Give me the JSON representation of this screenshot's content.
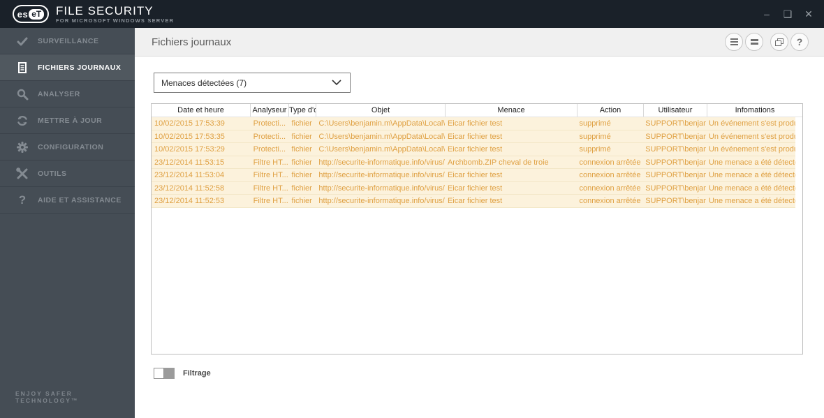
{
  "brand": {
    "logo_left": "es",
    "logo_right": "eT",
    "product": "FILE SECURITY",
    "subtitle": "FOR MICROSOFT WINDOWS SERVER"
  },
  "window_controls": {
    "minimize_glyph": "–",
    "maximize_glyph": "❑",
    "close_glyph": "✕"
  },
  "sidebar": {
    "items": [
      {
        "label": "SURVEILLANCE",
        "icon": "check-icon",
        "active": false
      },
      {
        "label": "FICHIERS JOURNAUX",
        "icon": "log-file-icon",
        "active": true
      },
      {
        "label": "ANALYSER",
        "icon": "search-icon",
        "active": false
      },
      {
        "label": "METTRE À JOUR",
        "icon": "update-arrows-icon",
        "active": false
      },
      {
        "label": "CONFIGURATION",
        "icon": "gear-icon",
        "active": false
      },
      {
        "label": "OUTILS",
        "icon": "tools-icon",
        "active": false
      },
      {
        "label": "AIDE ET ASSISTANCE",
        "icon": "question-icon",
        "active": false
      }
    ],
    "footer": "ENJOY SAFER TECHNOLOGY™"
  },
  "page_header": {
    "title": "Fichiers journaux",
    "buttons": [
      {
        "name": "menu-button",
        "icon": "hamburger-icon"
      },
      {
        "name": "list-view-button",
        "icon": "thick-bars-icon"
      },
      {
        "name": "copy-button",
        "icon": "copy-window-icon"
      },
      {
        "name": "help-button",
        "icon": "question-icon",
        "glyph": "?"
      }
    ],
    "help_glyph": "?"
  },
  "filter_dropdown": {
    "value": "Menaces détectées (7)"
  },
  "table": {
    "columns": [
      {
        "label": "Date et heure"
      },
      {
        "label": "Analyseur"
      },
      {
        "label": "Type d'o..."
      },
      {
        "label": "Objet"
      },
      {
        "label": "Menace"
      },
      {
        "label": "Action"
      },
      {
        "label": "Utilisateur"
      },
      {
        "label": "Infomations"
      }
    ],
    "rows": [
      [
        "10/02/2015 17:53:39",
        "Protecti...",
        "fichier",
        "C:\\Users\\benjamin.m\\AppData\\Local\\Mi...",
        "Eicar fichier test",
        "supprimé",
        "SUPPORT\\benjami...",
        "Un événement s'est produit su..."
      ],
      [
        "10/02/2015 17:53:35",
        "Protecti...",
        "fichier",
        "C:\\Users\\benjamin.m\\AppData\\Local\\Mi...",
        "Eicar fichier test",
        "supprimé",
        "SUPPORT\\benjami...",
        "Un événement s'est produit su..."
      ],
      [
        "10/02/2015 17:53:29",
        "Protecti...",
        "fichier",
        "C:\\Users\\benjamin.m\\AppData\\Local\\Mi...",
        "Eicar fichier test",
        "supprimé",
        "SUPPORT\\benjami...",
        "Un événement s'est produit su..."
      ],
      [
        "23/12/2014 11:53:15",
        "Filtre HT...",
        "fichier",
        "http://securite-informatique.info/virus/ei...",
        "Archbomb.ZIP cheval de troie",
        "connexion arrêtée - ...",
        "SUPPORT\\benjami...",
        "Une menace a été détectée lor..."
      ],
      [
        "23/12/2014 11:53:04",
        "Filtre HT...",
        "fichier",
        "http://securite-informatique.info/virus/ei...",
        "Eicar fichier test",
        "connexion arrêtée - ...",
        "SUPPORT\\benjami...",
        "Une menace a été détectée lor..."
      ],
      [
        "23/12/2014 11:52:58",
        "Filtre HT...",
        "fichier",
        "http://securite-informatique.info/virus/ei...",
        "Eicar fichier test",
        "connexion arrêtée - ...",
        "SUPPORT\\benjami...",
        "Une menace a été détectée lor..."
      ],
      [
        "23/12/2014 11:52:53",
        "Filtre HT...",
        "fichier",
        "http://securite-informatique.info/virus/ei...",
        "Eicar fichier test",
        "connexion arrêtée - ...",
        "SUPPORT\\benjami...",
        "Une menace a été détectée lor..."
      ]
    ]
  },
  "footer": {
    "filter_toggle_label": "Filtrage",
    "filter_toggle_state": "off"
  }
}
